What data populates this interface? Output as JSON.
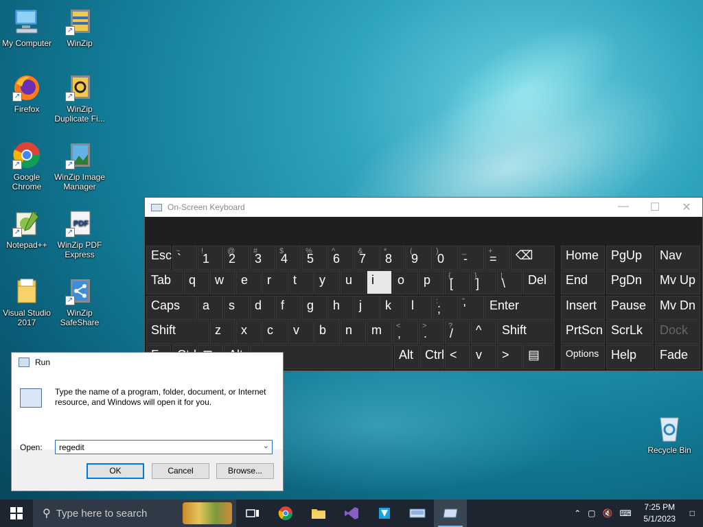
{
  "desktop": {
    "icons": [
      {
        "label": "My Computer"
      },
      {
        "label": "WinZip"
      },
      {
        "label": "Firefox"
      },
      {
        "label": "WinZip Duplicate Fi..."
      },
      {
        "label": "Google Chrome"
      },
      {
        "label": "WinZip Image Manager"
      },
      {
        "label": "Notepad++"
      },
      {
        "label": "WinZip PDF Express"
      },
      {
        "label": "Visual Studio 2017"
      },
      {
        "label": "WinZip SafeShare"
      },
      {
        "label": "Recycle Bin"
      }
    ]
  },
  "osk": {
    "title": "On-Screen Keyboard",
    "controls": {
      "minimize": "—",
      "maximize": "☐",
      "close": "✕"
    },
    "row1": [
      {
        "m": "Esc"
      },
      {
        "s": "~",
        "m": "`"
      },
      {
        "s": "!",
        "m": "1"
      },
      {
        "s": "@",
        "m": "2"
      },
      {
        "s": "#",
        "m": "3"
      },
      {
        "s": "$",
        "m": "4"
      },
      {
        "s": "%",
        "m": "5"
      },
      {
        "s": "^",
        "m": "6"
      },
      {
        "s": "&",
        "m": "7"
      },
      {
        "s": "*",
        "m": "8"
      },
      {
        "s": "(",
        "m": "9"
      },
      {
        "s": ")",
        "m": "0"
      },
      {
        "s": "_",
        "m": "-"
      },
      {
        "s": "+",
        "m": "="
      },
      {
        "m": "⌫"
      }
    ],
    "row2": [
      {
        "m": "Tab"
      },
      {
        "m": "q"
      },
      {
        "m": "w"
      },
      {
        "m": "e"
      },
      {
        "m": "r"
      },
      {
        "m": "t"
      },
      {
        "m": "y"
      },
      {
        "m": "u"
      },
      {
        "m": "i",
        "highlight": true
      },
      {
        "m": "o"
      },
      {
        "m": "p"
      },
      {
        "s": "{",
        "m": "["
      },
      {
        "s": "}",
        "m": "]"
      },
      {
        "s": "|",
        "m": "\\"
      },
      {
        "m": "Del"
      }
    ],
    "row3": [
      {
        "m": "Caps"
      },
      {
        "m": "a"
      },
      {
        "m": "s"
      },
      {
        "m": "d"
      },
      {
        "m": "f"
      },
      {
        "m": "g"
      },
      {
        "m": "h"
      },
      {
        "m": "j"
      },
      {
        "m": "k"
      },
      {
        "m": "l"
      },
      {
        "s": ":",
        "m": ";"
      },
      {
        "s": "\"",
        "m": "'"
      },
      {
        "m": "Enter"
      }
    ],
    "row4": [
      {
        "m": "Shift"
      },
      {
        "m": "z"
      },
      {
        "m": "x"
      },
      {
        "m": "c"
      },
      {
        "m": "v"
      },
      {
        "m": "b"
      },
      {
        "m": "n"
      },
      {
        "m": "m"
      },
      {
        "s": "<",
        "m": ","
      },
      {
        "s": ">",
        "m": "."
      },
      {
        "s": "?",
        "m": "/"
      },
      {
        "m": "^"
      },
      {
        "m": "Shift"
      }
    ],
    "row5": [
      {
        "m": "Fn"
      },
      {
        "m": "Ctrl"
      },
      {
        "m": "⊞"
      },
      {
        "m": "Alt"
      },
      {
        "m": ""
      },
      {
        "m": "Alt"
      },
      {
        "m": "Ctrl"
      },
      {
        "m": "<"
      },
      {
        "m": "v"
      },
      {
        "m": ">"
      },
      {
        "m": "▤"
      }
    ],
    "nav": [
      [
        "Home",
        "PgUp",
        "Nav"
      ],
      [
        "End",
        "PgDn",
        "Mv Up"
      ],
      [
        "Insert",
        "Pause",
        "Mv Dn"
      ],
      [
        "PrtScn",
        "ScrLk",
        "Dock"
      ],
      [
        "Options",
        "Help",
        "Fade"
      ]
    ]
  },
  "run": {
    "title": "Run",
    "message": "Type the name of a program, folder, document, or Internet resource, and Windows will open it for you.",
    "open_label": "Open:",
    "open_value": "regedit",
    "ok": "OK",
    "cancel": "Cancel",
    "browse": "Browse..."
  },
  "taskbar": {
    "search_placeholder": "Type here to search",
    "time": "7:25 PM",
    "date": "5/1/2023"
  }
}
